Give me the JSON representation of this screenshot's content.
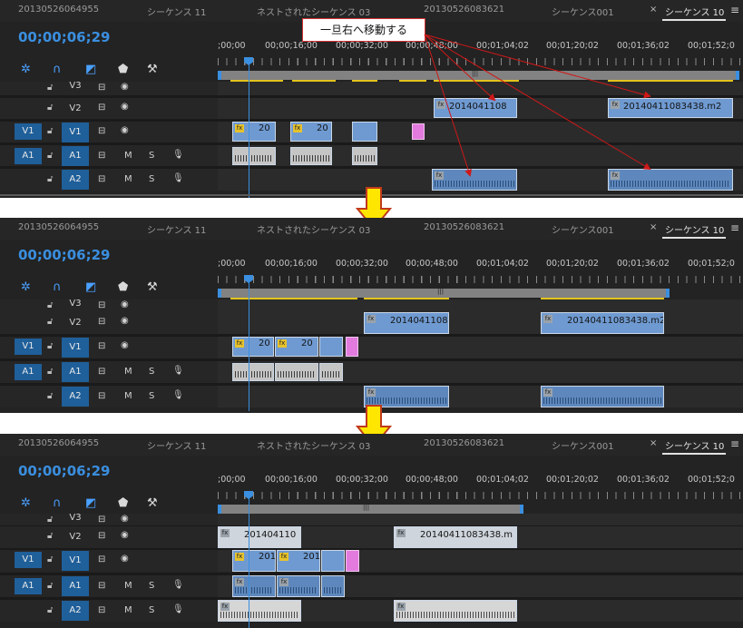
{
  "tabs": [
    {
      "label": "20130526064955"
    },
    {
      "label": "シーケンス 11"
    },
    {
      "label": "ネストされたシーケンス 03"
    },
    {
      "label": "20130526083621"
    },
    {
      "label": "シーケンス001"
    },
    {
      "label": "シーケンス 10"
    }
  ],
  "timecode": "00;00;06;29",
  "ruler_labels": [
    ";00;00",
    "00;00;16;00",
    "00;00;32;00",
    "00;00;48;00",
    "00;01;04;02",
    "00;01;20;02",
    "00;01;36;02",
    "00;01;52;0"
  ],
  "tracks": {
    "v3": "V3",
    "v2": "V2",
    "v1": "V1",
    "a1": "A1",
    "a2": "A2",
    "src_v1": "V1",
    "src_a1": "A1",
    "mute": "M",
    "solo": "S"
  },
  "clip_names": {
    "c1": "20",
    "c2": "20",
    "c_108": "2014041108",
    "c_m2": "20140411083438.m2",
    "c_110": "201404110",
    "c_m": "20140411083438.m",
    "c_201": "201"
  },
  "callout": "一旦右へ移動する",
  "colors": {
    "accent": "#3a8fe0",
    "workbar": "#e3c41c",
    "clip_video": "#6f9ad1",
    "clip_pink": "#e27bdd",
    "arrow_fill": "#ffe600",
    "arrow_stroke": "#c03a1c"
  }
}
